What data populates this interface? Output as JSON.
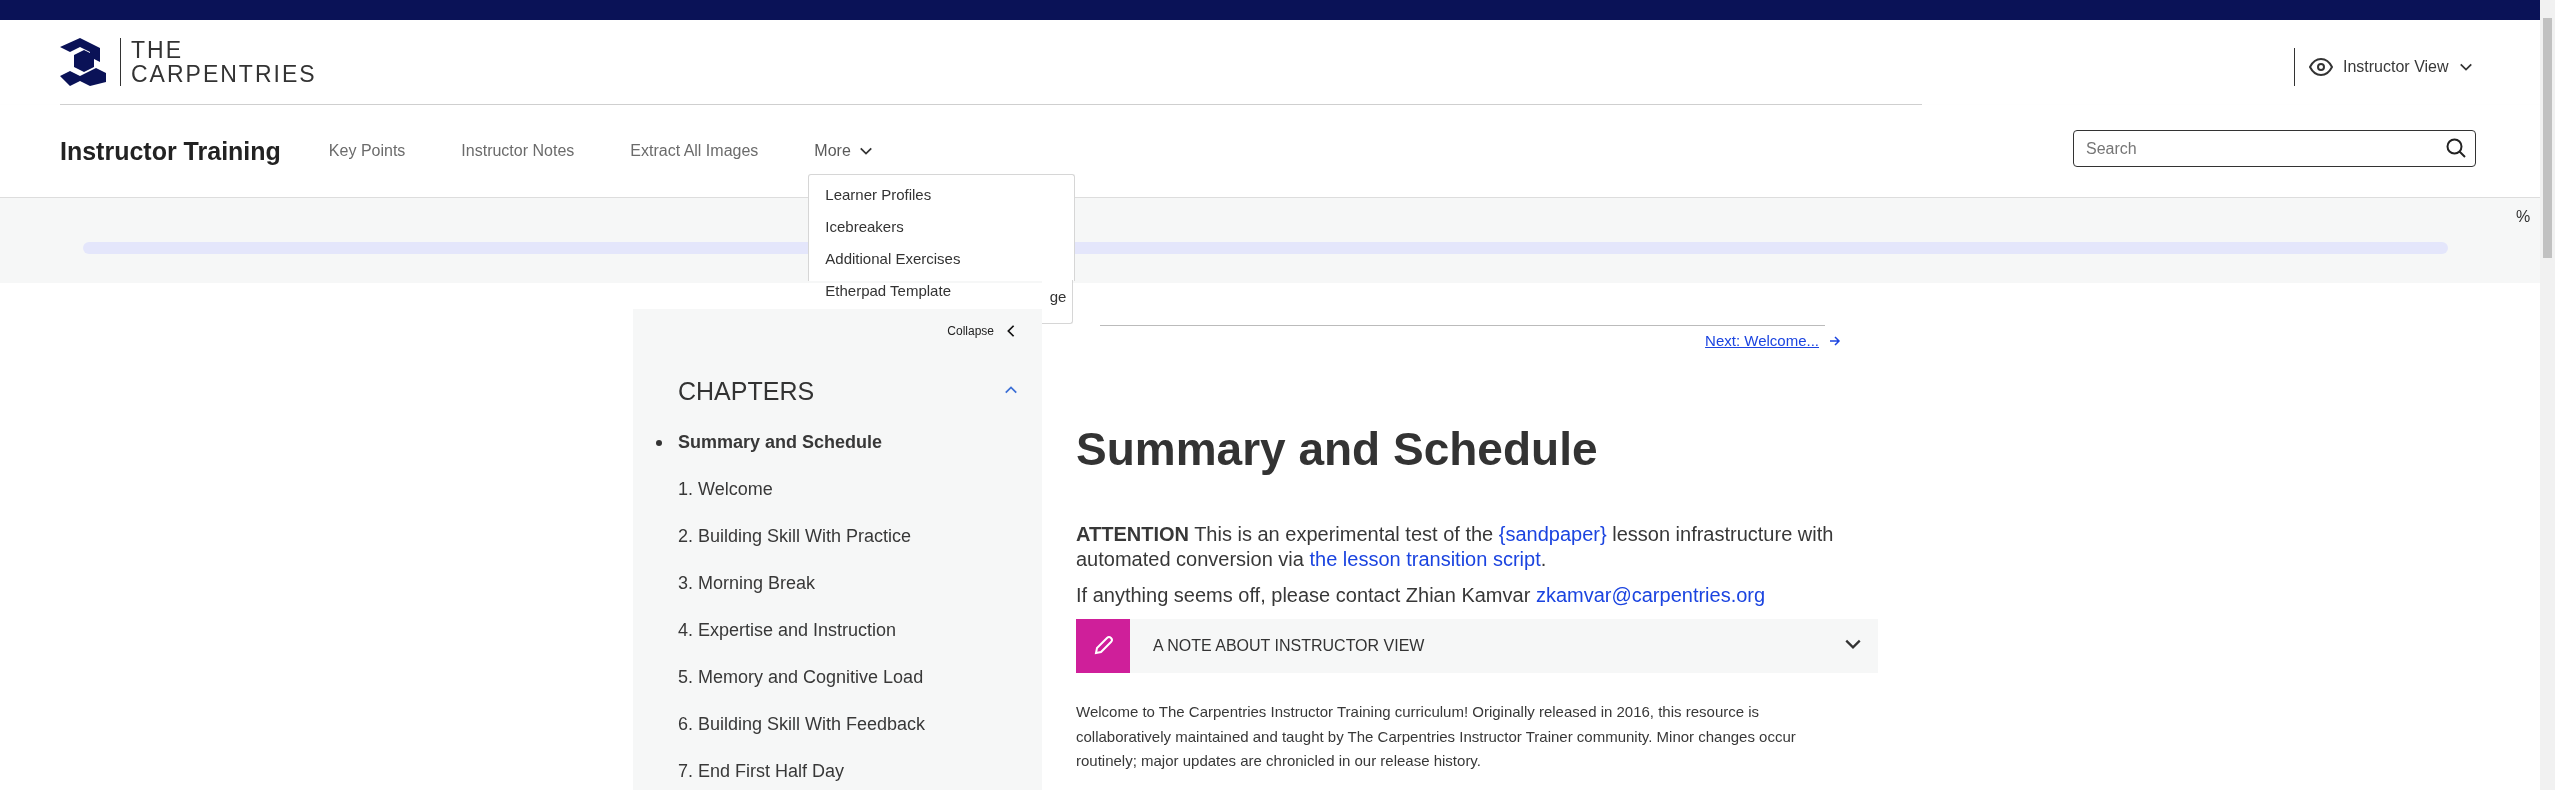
{
  "header": {
    "brand": {
      "line1": "THE",
      "line2": "CARPENTRIES"
    },
    "view_selector": {
      "label": "Instructor View"
    }
  },
  "navbar": {
    "lesson_title": "Instructor Training",
    "links": [
      {
        "label": "Key Points"
      },
      {
        "label": "Instructor Notes"
      },
      {
        "label": "Extract All Images"
      }
    ],
    "more_menu": {
      "label": "More",
      "expanded": true,
      "items": [
        {
          "label": "Learner Profiles"
        },
        {
          "label": "Icebreakers"
        },
        {
          "label": "Additional Exercises"
        },
        {
          "label": "Etherpad Template"
        },
        {
          "label": "ge"
        }
      ]
    },
    "search": {
      "placeholder": "Search"
    }
  },
  "progress": {
    "label": "%"
  },
  "sidebar": {
    "collapse_label": "Collapse",
    "heading": "CHAPTERS",
    "expanded": true,
    "chapters": [
      {
        "label": "Summary and Schedule",
        "selected": true
      },
      {
        "label": "1. Welcome",
        "selected": false
      },
      {
        "label": "2. Building Skill With Practice",
        "selected": false
      },
      {
        "label": "3. Morning Break",
        "selected": false
      },
      {
        "label": "4. Expertise and Instruction",
        "selected": false
      },
      {
        "label": "5. Memory and Cognitive Load",
        "selected": false
      },
      {
        "label": "6. Building Skill With Feedback",
        "selected": false
      },
      {
        "label": "7. End First Half Day",
        "selected": false
      }
    ]
  },
  "content": {
    "next_link": "Next: Welcome...",
    "title": "Summary and Schedule",
    "paragraphs": [
      [
        {
          "kind": "bold",
          "text": "ATTENTION"
        },
        {
          "kind": "plain",
          "text": " This is an experimental test of the "
        },
        {
          "kind": "link",
          "text": "{sandpaper}"
        },
        {
          "kind": "plain",
          "text": " lesson infrastructure with automated conversion via "
        },
        {
          "kind": "link",
          "text": "the lesson transition script"
        },
        {
          "kind": "plain",
          "text": "."
        }
      ],
      [
        {
          "kind": "plain",
          "text": "If anything seems off, please contact Zhian Kamvar "
        },
        {
          "kind": "link",
          "text": "zkamvar@carpentries.org"
        }
      ]
    ],
    "note": {
      "title": "A NOTE ABOUT INSTRUCTOR VIEW",
      "expanded": false
    },
    "body": "Welcome to The Carpentries Instructor Training curriculum! Originally released in 2016, this resource is collaboratively maintained and taught by The Carpentries Instructor Trainer community. Minor changes occur routinely; major updates are chronicled in our release history."
  }
}
